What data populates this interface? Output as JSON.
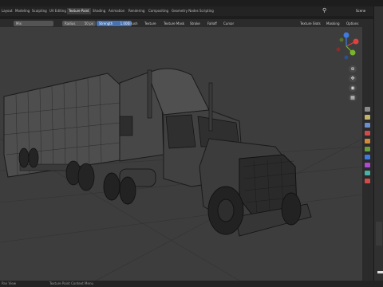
{
  "topbar": {
    "tabs": [
      {
        "label": "Layout",
        "active": false
      },
      {
        "label": "Modeling",
        "active": false
      },
      {
        "label": "Sculpting",
        "active": false
      },
      {
        "label": "UV Editing",
        "active": false
      },
      {
        "label": "Texture Paint",
        "active": true
      },
      {
        "label": "Shading",
        "active": false
      },
      {
        "label": "Animation",
        "active": false
      },
      {
        "label": "Rendering",
        "active": false
      },
      {
        "label": "Compositing",
        "active": false
      },
      {
        "label": "Geometry Nodes",
        "active": false
      },
      {
        "label": "Scripting",
        "active": false
      }
    ],
    "scene_label": "Scene"
  },
  "tool_header": {
    "mode": "Mix",
    "radius_label": "Radius",
    "radius_value": "50 px",
    "strength_label": "Strength",
    "strength_value": "1.000",
    "menus": [
      "Brush",
      "Texture",
      "Texture Mask",
      "Stroke",
      "Falloff",
      "Cursor"
    ],
    "right_menus": [
      "Texture Slots",
      "Masking",
      "Options"
    ]
  },
  "statusbar": {
    "left": "Pan View",
    "center": "Texture Paint Context Menu"
  },
  "colors": {
    "accent": "#4772b3",
    "viewport_bg": "#3d3d3d",
    "wire": "#1a1a1a",
    "gizmo_x": "#e2403c",
    "gizmo_y": "#79b52a",
    "gizmo_z": "#3f7ae0"
  },
  "icons": [
    "search-icon",
    "gizmo-x-icon",
    "gizmo-y-icon",
    "gizmo-z-icon",
    "zoom-icon",
    "pan-icon",
    "camera-icon",
    "grid-icon"
  ]
}
